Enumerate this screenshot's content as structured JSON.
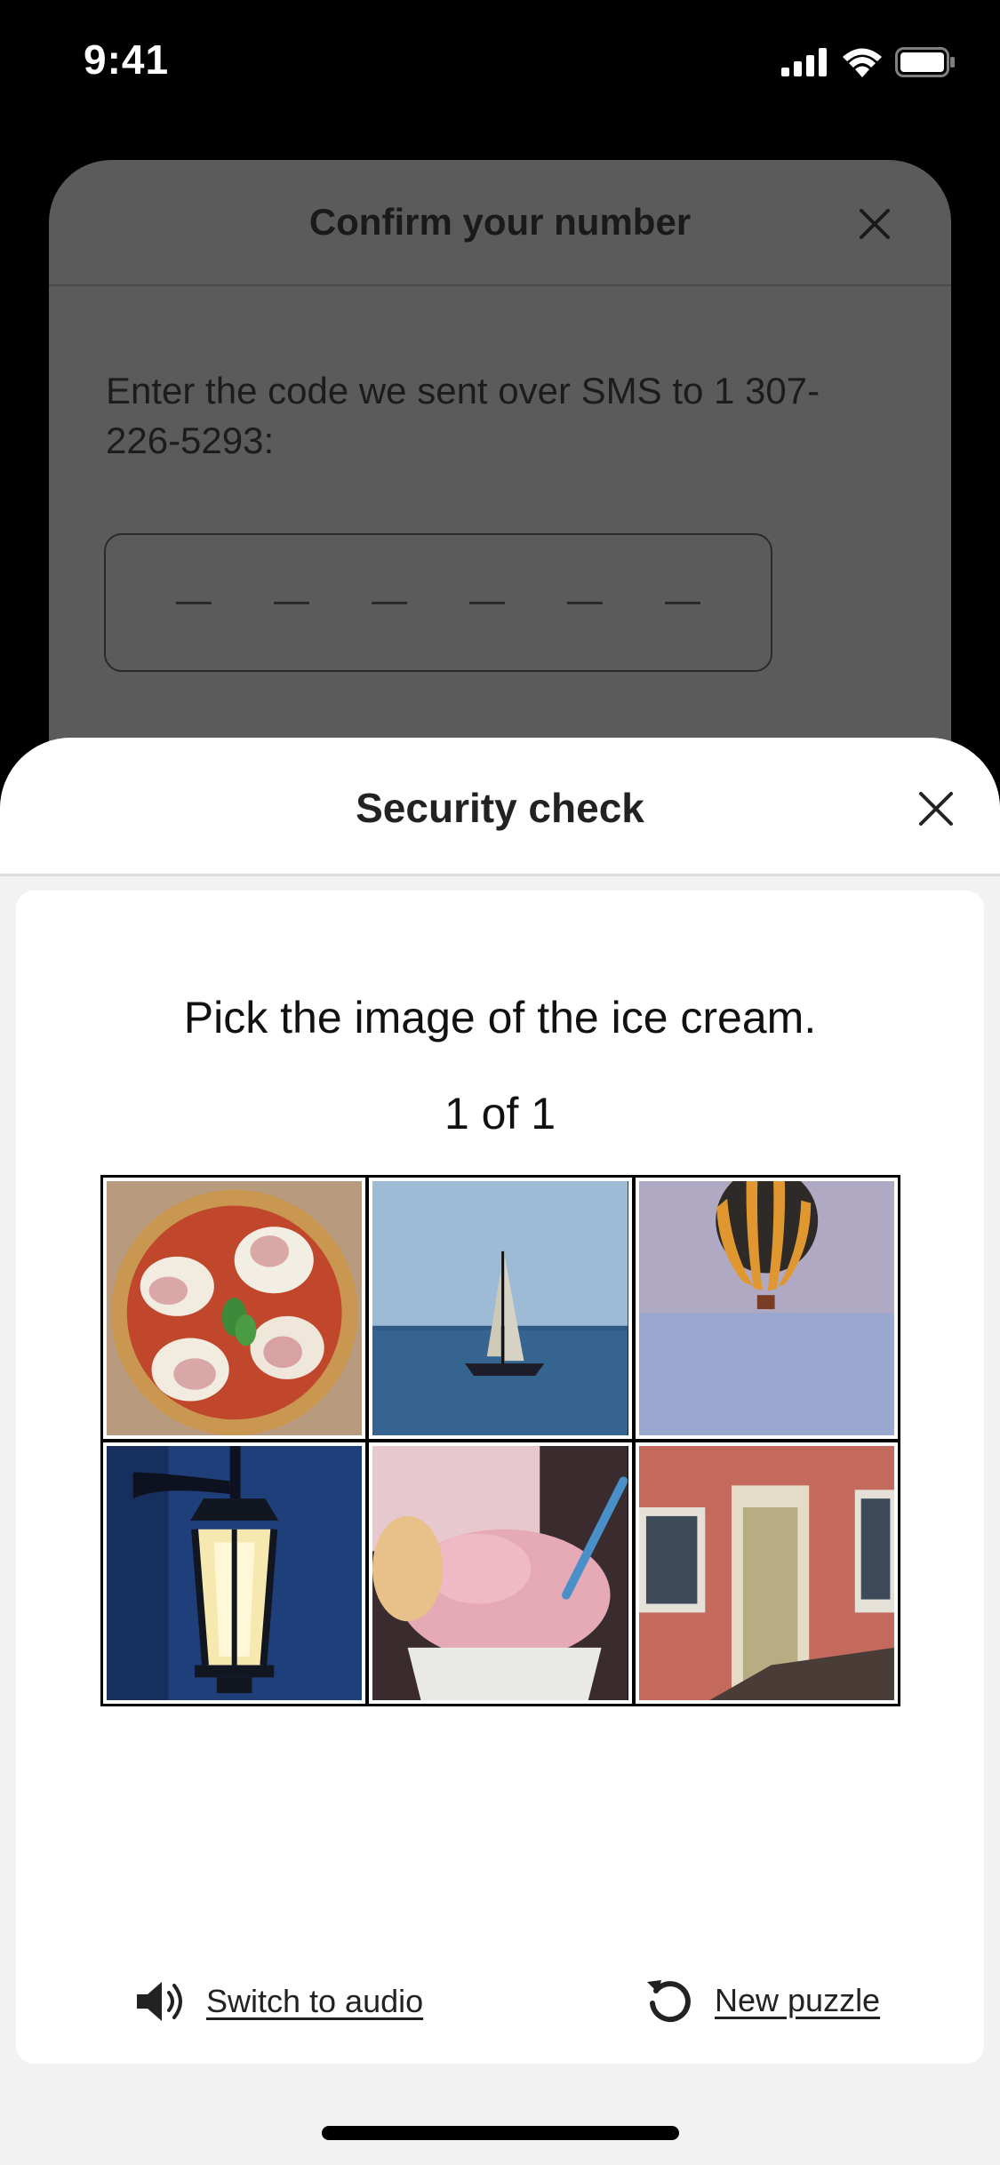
{
  "status_bar": {
    "time": "9:41"
  },
  "confirm_sheet": {
    "title": "Confirm your number",
    "description": "Enter the code we sent over SMS to 1 307-226-5293:",
    "code_digits": [
      "",
      "",
      "",
      "",
      "",
      ""
    ]
  },
  "security_sheet": {
    "title": "Security check",
    "prompt": "Pick the image of the ice cream.",
    "counter": "1 of 1",
    "tiles": [
      {
        "icon": "pizza-image"
      },
      {
        "icon": "sailboat-image"
      },
      {
        "icon": "hot-air-balloon-image"
      },
      {
        "icon": "lantern-image"
      },
      {
        "icon": "ice-cream-image"
      },
      {
        "icon": "house-door-image"
      }
    ],
    "switch_audio_label": "Switch to audio",
    "new_puzzle_label": "New puzzle"
  }
}
